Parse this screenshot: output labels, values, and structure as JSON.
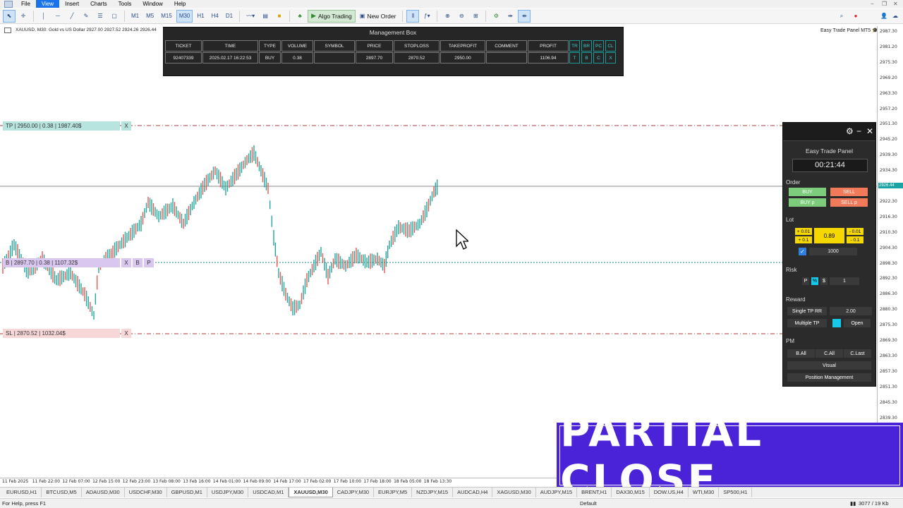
{
  "menu": {
    "items": [
      "File",
      "View",
      "Insert",
      "Charts",
      "Tools",
      "Window",
      "Help"
    ],
    "active": "View"
  },
  "toolbar": {
    "timeframes": [
      "M1",
      "M5",
      "M15",
      "M30",
      "H1",
      "H4",
      "D1"
    ],
    "active_timeframe": "M30",
    "algo_trading": "Algo Trading",
    "new_order": "New Order"
  },
  "chart": {
    "title": "XAUUSD, M30:  Gold vs US Dollar  2927.00 2927.52 2924.26 2926.44",
    "badge": "Easy Trade Panel MT5",
    "price_labels": [
      "2987.30",
      "2981.20",
      "2975.30",
      "2969.20",
      "2963.30",
      "2957.20",
      "2951.30",
      "2945.20",
      "2939.30",
      "2934.30",
      "2928.30",
      "2922.30",
      "2916.30",
      "2910.30",
      "2904.30",
      "2898.30",
      "2892.30",
      "2886.30",
      "2880.30",
      "2875.30",
      "2869.30",
      "2863.30",
      "2857.30",
      "2851.30",
      "2845.30",
      "2839.30"
    ],
    "current_price": "2926.44",
    "time_labels": [
      "11 Feb 2025",
      "11 Feb 22:00",
      "12 Feb 07:00",
      "12 Feb 15:00",
      "12 Feb 23:00",
      "13 Feb 08:00",
      "13 Feb 16:00",
      "14 Feb 01:00",
      "14 Feb 09:00",
      "14 Feb 17:00",
      "17 Feb 02:00",
      "17 Feb 10:00",
      "17 Feb 18:00",
      "18 Feb 05:00",
      "18 Feb 13:30"
    ],
    "lines": {
      "tp": {
        "label": "TP | 2950.00 | 0.38 | 1987.40$",
        "btn": "X",
        "color": "#b7e4de"
      },
      "entry": {
        "label": "B | 2897.70 | 0.38 | 1107.32$",
        "buttons": [
          "X",
          "B",
          "P"
        ],
        "color": "#d9c7ef"
      },
      "sl": {
        "label": "SL | 2870.52 | 1032.04$",
        "btn": "X",
        "color": "#f8d7d9"
      }
    }
  },
  "management_box": {
    "title": "Management Box",
    "headers": [
      "TICKET",
      "TIME",
      "TYPE",
      "VOLUME",
      "SYMBOL",
      "PRICE",
      "STOPLOSS",
      "TAKEPROFIT",
      "COMMENT",
      "PROFIT"
    ],
    "row": [
      "92407339",
      "2025.02.17 16:22:53",
      "BUY",
      "0.38",
      "",
      "2897.70",
      "2870.52",
      "2950.00",
      "",
      "1106.94"
    ],
    "header_buttons": [
      "TR",
      "BR",
      "PC",
      "CL"
    ],
    "row_buttons": [
      "T",
      "B",
      "C",
      "X"
    ]
  },
  "panel": {
    "title": "Easy Trade Panel",
    "timer": "00:21:44",
    "order_label": "Order",
    "buy": "BUY",
    "sell": "SELL",
    "buy_p": "BUY p",
    "sell_p": "SELL p",
    "lot_label": "Lot",
    "lot_steps": [
      "+ 0.01",
      "+ 0.1",
      "- 0.01",
      "- 0.1"
    ],
    "lot_value": "0.89",
    "lot_money": "1000",
    "risk_label": "Risk",
    "risk_modes": [
      "P",
      "%",
      "$"
    ],
    "risk_value": "1",
    "reward_label": "Reward",
    "single_tp_rr": "Single TP RR",
    "rr_value": "2.00",
    "multiple_tp": "Multiple TP",
    "open": "Open",
    "pm_label": "PM",
    "b_all": "B.All",
    "c_all": "C.All",
    "c_last": "C.Last",
    "visual": "Visual",
    "position_management": "Position Management",
    "colors": {
      "buy": "#7ccc7c",
      "sell": "#f07a5a",
      "lot": "#f5d800",
      "accent": "#18c8e8"
    }
  },
  "banner": {
    "text": "PARTIAL CLOSE",
    "color": "#4a22d8"
  },
  "symbol_tabs": [
    "EURUSD,H1",
    "BTCUSD,M5",
    "ADAUSD,M30",
    "USDCHF,M30",
    "GBPUSD,M1",
    "USDJPY,M30",
    "USDCAD,M1",
    "XAUUSD,M30",
    "CADJPY,M30",
    "EURJPY,M5",
    "NZDJPY,M15",
    "AUDCAD,H4",
    "XAGUSD,M30",
    "AUDJPY,M15",
    "BRENT,H1",
    "DAX30,M15",
    "DOW.US,H4",
    "WTI,M30",
    "SP500,H1"
  ],
  "active_tab": "XAUUSD,M30",
  "status": {
    "help": "For Help, press F1",
    "profile": "Default",
    "traffic": "3077 / 19 Kb"
  }
}
